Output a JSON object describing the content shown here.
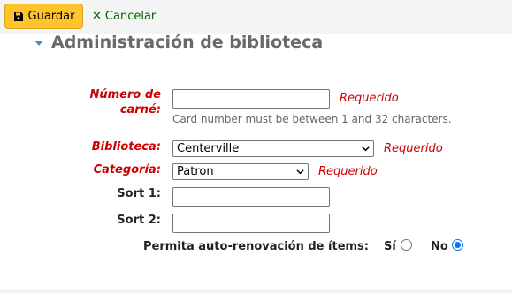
{
  "toolbar": {
    "save_label": "Guardar",
    "cancel_label": "Cancelar"
  },
  "section": {
    "title": "Administración de biblioteca"
  },
  "fields": {
    "cardnumber": {
      "label_line1": "Número de",
      "label_line2": "carné:",
      "value": "",
      "required_text": "Requerido",
      "hint": "Card number must be between 1 and 32 characters."
    },
    "branch": {
      "label": "Biblioteca:",
      "selected": "Centerville",
      "required_text": "Requerido"
    },
    "category": {
      "label": "Categoría:",
      "selected": "Patron",
      "required_text": "Requerido"
    },
    "sort1": {
      "label": "Sort 1:",
      "value": ""
    },
    "sort2": {
      "label": "Sort 2:",
      "value": ""
    },
    "autorenew": {
      "label": "Permita auto-renovación de ítems:",
      "yes_label": "Sí",
      "no_label": "No",
      "selected": "No"
    }
  },
  "colors": {
    "save_button": "#ffc32b",
    "cancel_link": "#006100",
    "required": "#cc0000",
    "radio_checked": "#0075ff"
  }
}
